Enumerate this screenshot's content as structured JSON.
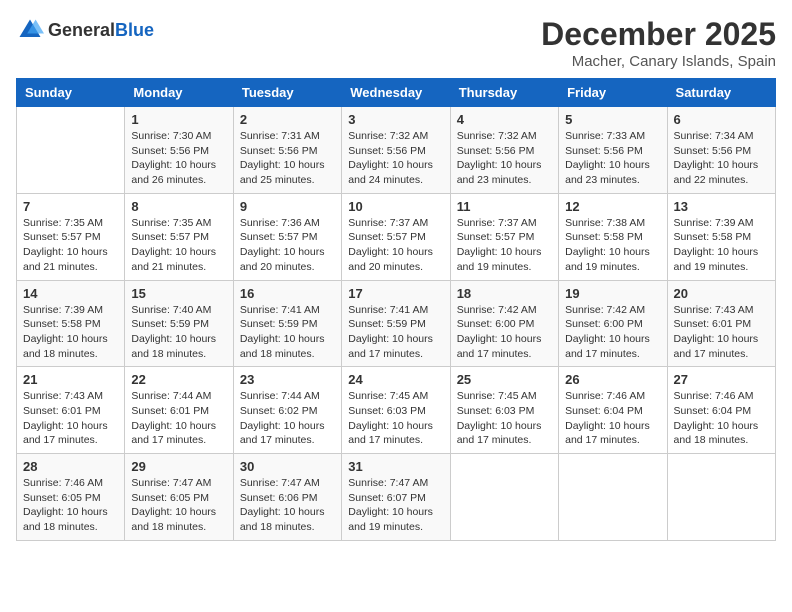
{
  "header": {
    "logo_general": "General",
    "logo_blue": "Blue",
    "month": "December 2025",
    "location": "Macher, Canary Islands, Spain"
  },
  "days_of_week": [
    "Sunday",
    "Monday",
    "Tuesday",
    "Wednesday",
    "Thursday",
    "Friday",
    "Saturday"
  ],
  "weeks": [
    [
      {
        "day": "",
        "content": ""
      },
      {
        "day": "1",
        "content": "Sunrise: 7:30 AM\nSunset: 5:56 PM\nDaylight: 10 hours\nand 26 minutes."
      },
      {
        "day": "2",
        "content": "Sunrise: 7:31 AM\nSunset: 5:56 PM\nDaylight: 10 hours\nand 25 minutes."
      },
      {
        "day": "3",
        "content": "Sunrise: 7:32 AM\nSunset: 5:56 PM\nDaylight: 10 hours\nand 24 minutes."
      },
      {
        "day": "4",
        "content": "Sunrise: 7:32 AM\nSunset: 5:56 PM\nDaylight: 10 hours\nand 23 minutes."
      },
      {
        "day": "5",
        "content": "Sunrise: 7:33 AM\nSunset: 5:56 PM\nDaylight: 10 hours\nand 23 minutes."
      },
      {
        "day": "6",
        "content": "Sunrise: 7:34 AM\nSunset: 5:56 PM\nDaylight: 10 hours\nand 22 minutes."
      }
    ],
    [
      {
        "day": "7",
        "content": "Sunrise: 7:35 AM\nSunset: 5:57 PM\nDaylight: 10 hours\nand 21 minutes."
      },
      {
        "day": "8",
        "content": "Sunrise: 7:35 AM\nSunset: 5:57 PM\nDaylight: 10 hours\nand 21 minutes."
      },
      {
        "day": "9",
        "content": "Sunrise: 7:36 AM\nSunset: 5:57 PM\nDaylight: 10 hours\nand 20 minutes."
      },
      {
        "day": "10",
        "content": "Sunrise: 7:37 AM\nSunset: 5:57 PM\nDaylight: 10 hours\nand 20 minutes."
      },
      {
        "day": "11",
        "content": "Sunrise: 7:37 AM\nSunset: 5:57 PM\nDaylight: 10 hours\nand 19 minutes."
      },
      {
        "day": "12",
        "content": "Sunrise: 7:38 AM\nSunset: 5:58 PM\nDaylight: 10 hours\nand 19 minutes."
      },
      {
        "day": "13",
        "content": "Sunrise: 7:39 AM\nSunset: 5:58 PM\nDaylight: 10 hours\nand 19 minutes."
      }
    ],
    [
      {
        "day": "14",
        "content": "Sunrise: 7:39 AM\nSunset: 5:58 PM\nDaylight: 10 hours\nand 18 minutes."
      },
      {
        "day": "15",
        "content": "Sunrise: 7:40 AM\nSunset: 5:59 PM\nDaylight: 10 hours\nand 18 minutes."
      },
      {
        "day": "16",
        "content": "Sunrise: 7:41 AM\nSunset: 5:59 PM\nDaylight: 10 hours\nand 18 minutes."
      },
      {
        "day": "17",
        "content": "Sunrise: 7:41 AM\nSunset: 5:59 PM\nDaylight: 10 hours\nand 17 minutes."
      },
      {
        "day": "18",
        "content": "Sunrise: 7:42 AM\nSunset: 6:00 PM\nDaylight: 10 hours\nand 17 minutes."
      },
      {
        "day": "19",
        "content": "Sunrise: 7:42 AM\nSunset: 6:00 PM\nDaylight: 10 hours\nand 17 minutes."
      },
      {
        "day": "20",
        "content": "Sunrise: 7:43 AM\nSunset: 6:01 PM\nDaylight: 10 hours\nand 17 minutes."
      }
    ],
    [
      {
        "day": "21",
        "content": "Sunrise: 7:43 AM\nSunset: 6:01 PM\nDaylight: 10 hours\nand 17 minutes."
      },
      {
        "day": "22",
        "content": "Sunrise: 7:44 AM\nSunset: 6:01 PM\nDaylight: 10 hours\nand 17 minutes."
      },
      {
        "day": "23",
        "content": "Sunrise: 7:44 AM\nSunset: 6:02 PM\nDaylight: 10 hours\nand 17 minutes."
      },
      {
        "day": "24",
        "content": "Sunrise: 7:45 AM\nSunset: 6:03 PM\nDaylight: 10 hours\nand 17 minutes."
      },
      {
        "day": "25",
        "content": "Sunrise: 7:45 AM\nSunset: 6:03 PM\nDaylight: 10 hours\nand 17 minutes."
      },
      {
        "day": "26",
        "content": "Sunrise: 7:46 AM\nSunset: 6:04 PM\nDaylight: 10 hours\nand 17 minutes."
      },
      {
        "day": "27",
        "content": "Sunrise: 7:46 AM\nSunset: 6:04 PM\nDaylight: 10 hours\nand 18 minutes."
      }
    ],
    [
      {
        "day": "28",
        "content": "Sunrise: 7:46 AM\nSunset: 6:05 PM\nDaylight: 10 hours\nand 18 minutes."
      },
      {
        "day": "29",
        "content": "Sunrise: 7:47 AM\nSunset: 6:05 PM\nDaylight: 10 hours\nand 18 minutes."
      },
      {
        "day": "30",
        "content": "Sunrise: 7:47 AM\nSunset: 6:06 PM\nDaylight: 10 hours\nand 18 minutes."
      },
      {
        "day": "31",
        "content": "Sunrise: 7:47 AM\nSunset: 6:07 PM\nDaylight: 10 hours\nand 19 minutes."
      },
      {
        "day": "",
        "content": ""
      },
      {
        "day": "",
        "content": ""
      },
      {
        "day": "",
        "content": ""
      }
    ]
  ]
}
